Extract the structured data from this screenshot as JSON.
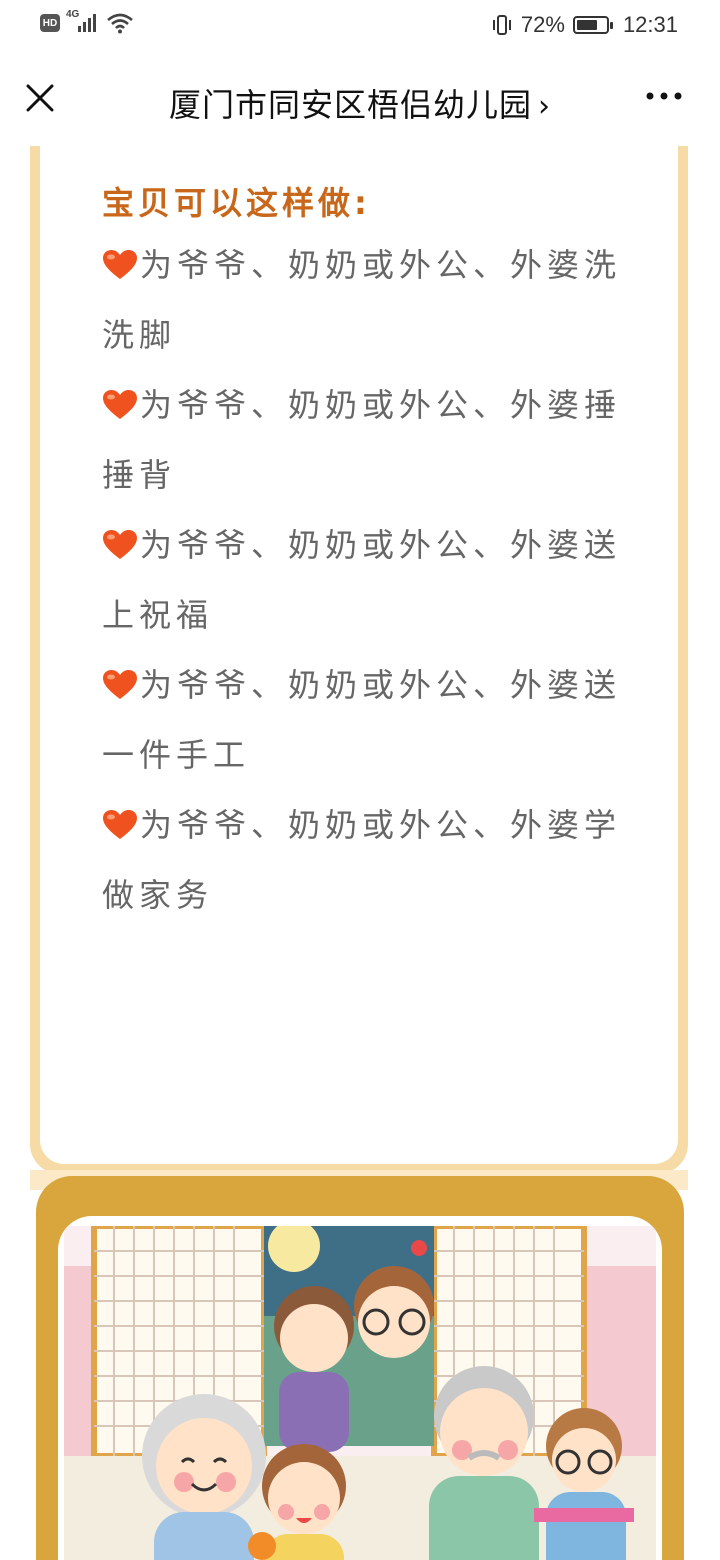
{
  "status_bar": {
    "hd_badge": "HD",
    "network_label": "4G",
    "battery_percent": "72%",
    "battery_level": 0.72,
    "time": "12:31",
    "icons": [
      "hd-icon",
      "signal-icon",
      "wifi-icon",
      "vibrate-icon",
      "battery-icon"
    ]
  },
  "title_bar": {
    "title": "厦门市同安区梧侣幼儿园",
    "chevron": "›",
    "icons": [
      "close-icon",
      "more-icon"
    ]
  },
  "article": {
    "heading": "宝贝可以这样做:",
    "items": [
      {
        "text": "为爷爷、奶奶或外公、外婆洗洗脚"
      },
      {
        "text": "为爷爷、奶奶或外公、外婆捶捶背"
      },
      {
        "text": "为爷爷、奶奶或外公、外婆送上祝福"
      },
      {
        "text": "为爷爷、奶奶或外公、外婆送一件手工"
      },
      {
        "text": "为爷爷、奶奶或外公、外婆学做家务"
      }
    ],
    "bullet_icon": "heart-icon",
    "colors": {
      "heading": "#c8671a",
      "text": "#666666",
      "card_border": "#f6dba6",
      "photo_frame": "#d8a63c",
      "heart": "#f0521f"
    }
  },
  "illustration": {
    "subject": "family-illustration"
  }
}
